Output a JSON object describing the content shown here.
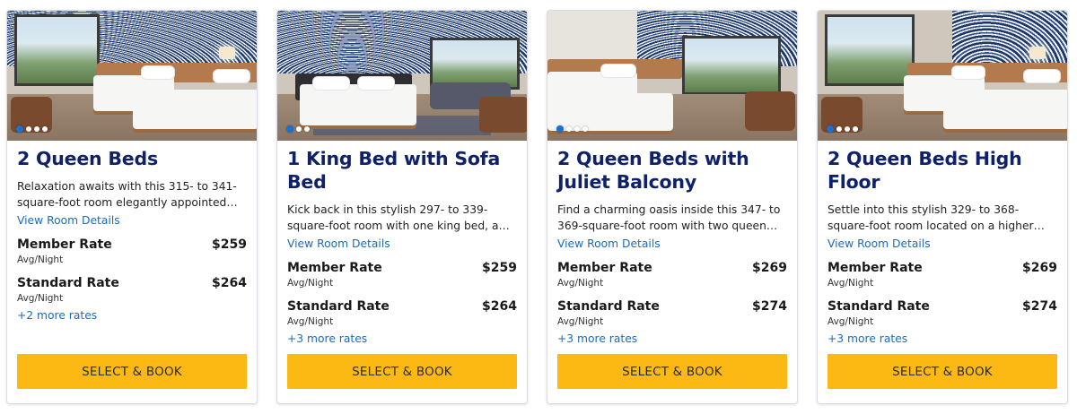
{
  "colors": {
    "title": "#0f2169",
    "link": "#1b6bbf",
    "button": "#fdb913",
    "dot_active": "#1d6fd1"
  },
  "rooms": [
    {
      "title": "2 Queen Beds",
      "description": "Relaxation awaits with this 315- to 341-square-foot room elegantly appointed with two que...",
      "details_link": "View Room Details",
      "photo_dots": 4,
      "rates": [
        {
          "label": "Member Rate",
          "price": "$259",
          "sub": "Avg/Night"
        },
        {
          "label": "Standard Rate",
          "price": "$264",
          "sub": "Avg/Night"
        }
      ],
      "more_rates": "+2 more rates",
      "button": "SELECT & BOOK"
    },
    {
      "title": "1 King Bed with Sofa Bed",
      "description": "Kick back in this stylish 297- to 339-square-foot room with one king bed, a comfortable seati...",
      "details_link": "View Room Details",
      "photo_dots": 3,
      "rates": [
        {
          "label": "Member Rate",
          "price": "$259",
          "sub": "Avg/Night"
        },
        {
          "label": "Standard Rate",
          "price": "$264",
          "sub": "Avg/Night"
        }
      ],
      "more_rates": "+3 more rates",
      "button": "SELECT & BOOK"
    },
    {
      "title": "2 Queen Beds with Juliet Balcony",
      "description": "Find a charming oasis inside this 347- to 369-square-foot room with two queen beds, a...",
      "details_link": "View Room Details",
      "photo_dots": 4,
      "rates": [
        {
          "label": "Member Rate",
          "price": "$269",
          "sub": "Avg/Night"
        },
        {
          "label": "Standard Rate",
          "price": "$274",
          "sub": "Avg/Night"
        }
      ],
      "more_rates": "+3 more rates",
      "button": "SELECT & BOOK"
    },
    {
      "title": "2 Queen Beds High Floor",
      "description": "Settle into this stylish 329- to 368-square-foot room located on a higher floor featuring...",
      "details_link": "View Room Details",
      "photo_dots": 4,
      "rates": [
        {
          "label": "Member Rate",
          "price": "$269",
          "sub": "Avg/Night"
        },
        {
          "label": "Standard Rate",
          "price": "$274",
          "sub": "Avg/Night"
        }
      ],
      "more_rates": "+3 more rates",
      "button": "SELECT & BOOK"
    }
  ]
}
